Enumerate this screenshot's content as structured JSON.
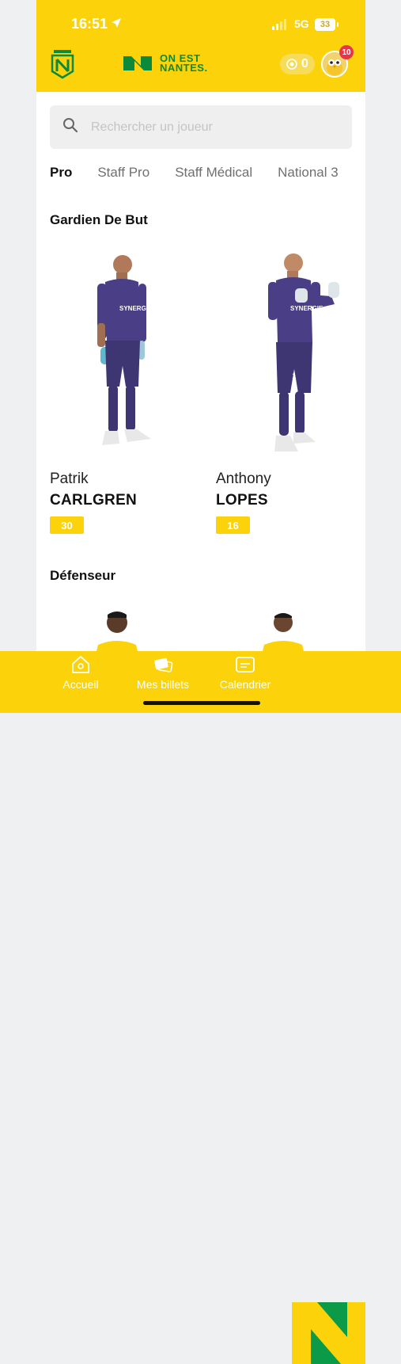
{
  "status_bar": {
    "time": "16:51",
    "network": "5G",
    "battery": "33"
  },
  "header": {
    "club_logo_text": "FC NANTES",
    "brand_line1": "ON EST",
    "brand_line2": "NANTES.",
    "points": "0",
    "notification_count": "10"
  },
  "search": {
    "placeholder": "Rechercher un joueur"
  },
  "tabs": [
    {
      "label": "Pro"
    },
    {
      "label": "Staff Pro"
    },
    {
      "label": "Staff Médical"
    },
    {
      "label": "National 3"
    }
  ],
  "sections": [
    {
      "title": "Gardien De But",
      "players": [
        {
          "first_name": "Patrik",
          "last_name": "CARLGREN",
          "number": "30"
        },
        {
          "first_name": "Anthony",
          "last_name": "LOPES",
          "number": "16"
        }
      ]
    },
    {
      "title": "Défenseur",
      "players": []
    }
  ],
  "colors": {
    "brand_yellow": "#fcd20a",
    "brand_green": "#0a8a3a",
    "kit_purple": "#4a3f86"
  },
  "bottom_nav": [
    {
      "label": "Accueil",
      "icon": "home-icon"
    },
    {
      "label": "Mes billets",
      "icon": "tickets-icon"
    },
    {
      "label": "Calendrier",
      "icon": "calendar-icon"
    }
  ]
}
